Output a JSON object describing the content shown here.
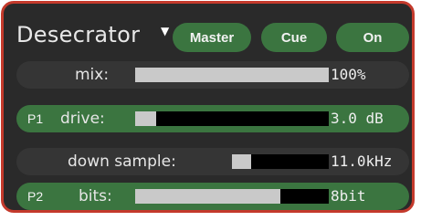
{
  "plugin": {
    "title": "Desecrator",
    "menu_arrow": "▼",
    "buttons": {
      "master": "Master",
      "cue": "Cue",
      "on": "On"
    }
  },
  "params": {
    "mix": {
      "label": "mix:",
      "value": "100%",
      "level": 1.0
    },
    "drive": {
      "tag": "P1",
      "label": "drive:",
      "value": "3.0 dB",
      "level": 0.11
    },
    "down_sample": {
      "label": "down sample:",
      "value": "11.0kHz",
      "level": 0.2
    },
    "bits": {
      "tag": "P2",
      "label": "bits:",
      "value": "8bit",
      "level": 0.75
    }
  },
  "colors": {
    "border": "#c43a2c",
    "panel": "#2a2a2a",
    "accent": "#3b7540",
    "fill": "#c9c9c9",
    "track": "#000000"
  }
}
